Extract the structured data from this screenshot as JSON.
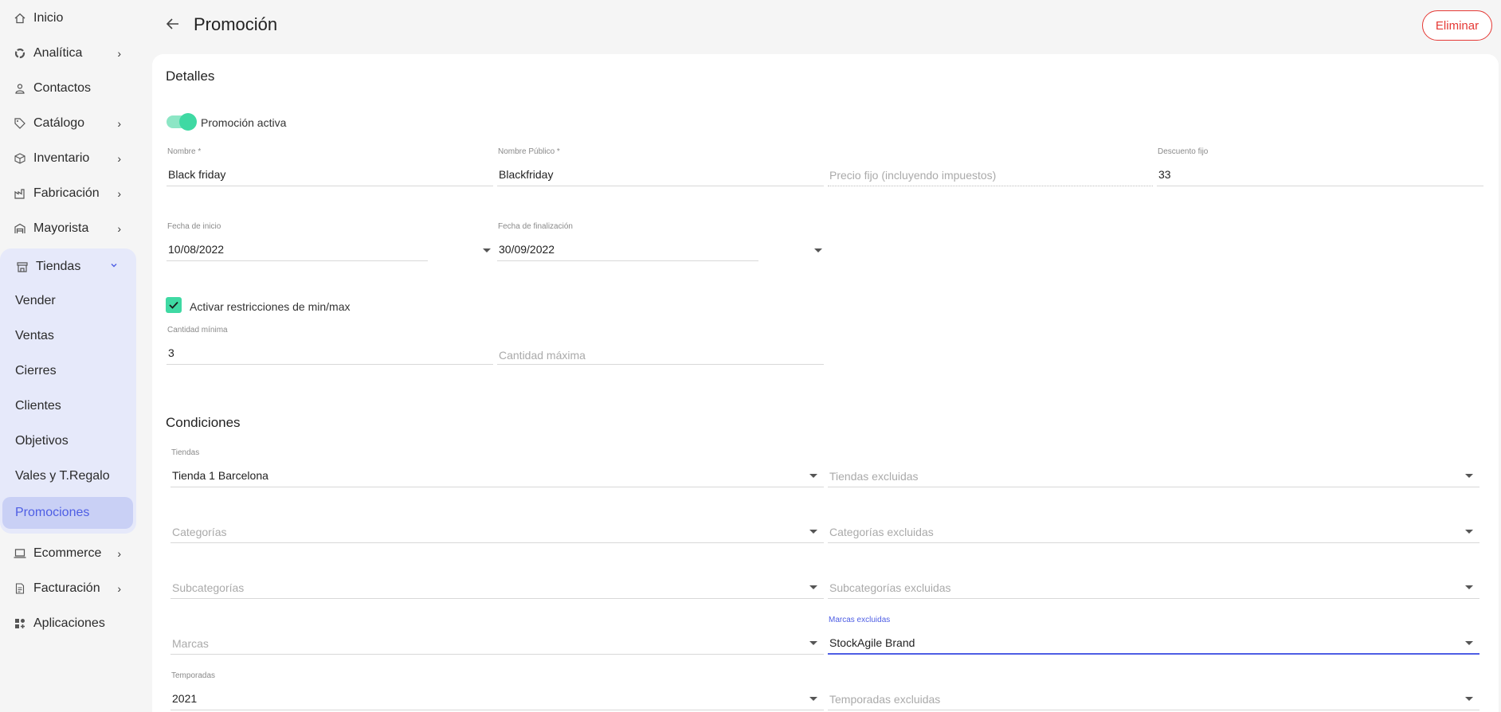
{
  "sidebar": {
    "items": [
      {
        "label": "Inicio",
        "icon": "home-icon"
      },
      {
        "label": "Analítica",
        "icon": "analytics-icon"
      },
      {
        "label": "Contactos",
        "icon": "user-icon"
      },
      {
        "label": "Catálogo",
        "icon": "tag-icon"
      },
      {
        "label": "Inventario",
        "icon": "box-icon"
      },
      {
        "label": "Fabricación",
        "icon": "factory-icon"
      },
      {
        "label": "Mayorista",
        "icon": "warehouse-icon"
      },
      {
        "label": "Tiendas",
        "icon": "store-icon"
      },
      {
        "label": "Ecommerce",
        "icon": "laptop-icon"
      },
      {
        "label": "Facturación",
        "icon": "invoice-icon"
      },
      {
        "label": "Aplicaciones",
        "icon": "apps-icon"
      }
    ],
    "tiendas_sub": [
      "Vender",
      "Ventas",
      "Cierres",
      "Clientes",
      "Objetivos",
      "Vales y T.Regalo",
      "Promociones"
    ],
    "active_sub": "Promociones"
  },
  "header": {
    "title": "Promoción",
    "delete_label": "Eliminar"
  },
  "details": {
    "section_title": "Detalles",
    "active_label": "Promoción activa",
    "active": true,
    "nombre_label": "Nombre *",
    "nombre_value": "Black friday",
    "nombre_publico_label": "Nombre Público *",
    "nombre_publico_value": "Blackfriday",
    "precio_fijo_placeholder": "Precio fijo (incluyendo impuestos)",
    "descuento_label": "Descuento fijo",
    "descuento_value": "33",
    "fecha_inicio_label": "Fecha de inicio",
    "fecha_inicio_value": "10/08/2022",
    "fecha_fin_label": "Fecha de finalización",
    "fecha_fin_value": "30/09/2022",
    "minmax_label": "Activar restricciones de min/max",
    "minmax_checked": true,
    "cantidad_min_label": "Cantidad mínima",
    "cantidad_min_value": "3",
    "cantidad_max_placeholder": "Cantidad máxima"
  },
  "conditions": {
    "section_title": "Condiciones",
    "tiendas_label": "Tiendas",
    "tiendas_value": "Tienda 1 Barcelona",
    "tiendas_excl_placeholder": "Tiendas excluidas",
    "categorias_placeholder": "Categorías",
    "categorias_excl_placeholder": "Categorías excluidas",
    "subcategorias_placeholder": "Subcategorías",
    "subcategorias_excl_placeholder": "Subcategorías excluidas",
    "marcas_placeholder": "Marcas",
    "marcas_excl_label": "Marcas excluidas",
    "marcas_excl_value": "StockAgile Brand",
    "temporadas_label": "Temporadas",
    "temporadas_value": "2021",
    "temporadas_excl_placeholder": "Temporadas excluidas"
  },
  "colors": {
    "accent": "#4e5ee4",
    "toggle": "#3fd9a3",
    "danger": "#e53935"
  }
}
